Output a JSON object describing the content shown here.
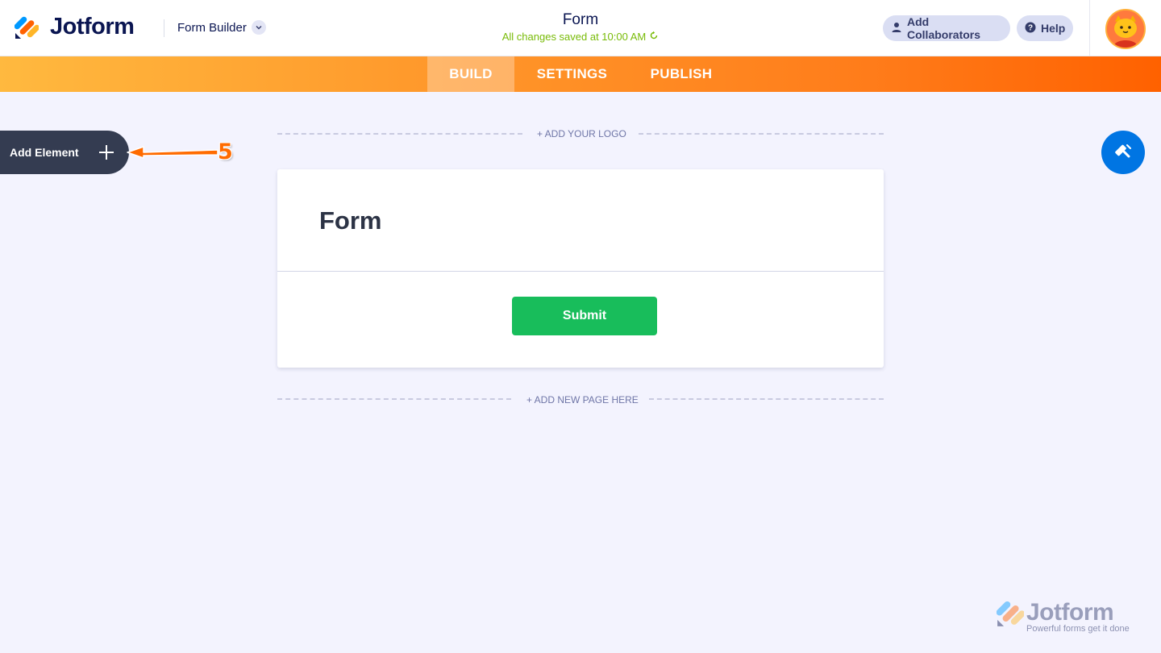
{
  "header": {
    "brand": "Jotform",
    "builder_label": "Form Builder",
    "form_title": "Form",
    "save_status": "All changes saved at 10:00 AM",
    "collaborators_label": "Add Collaborators",
    "help_label": "Help"
  },
  "tabs": [
    {
      "label": "BUILD",
      "active": true
    },
    {
      "label": "SETTINGS",
      "active": false
    },
    {
      "label": "PUBLISH",
      "active": false
    }
  ],
  "canvas": {
    "add_element_label": "Add Element",
    "add_logo_label": "+ ADD YOUR LOGO",
    "form_heading": "Form",
    "submit_label": "Submit",
    "add_page_label": "+ ADD NEW PAGE HERE"
  },
  "annotation": {
    "step_number": "5",
    "color": "#ff6b00"
  },
  "watermark": {
    "brand": "Jotform",
    "tagline": "Powerful forms get it done"
  },
  "colors": {
    "accent_orange": "#ff6100",
    "submit_green": "#18bd5b",
    "designer_blue": "#0075e3",
    "status_green": "#78bb07"
  }
}
